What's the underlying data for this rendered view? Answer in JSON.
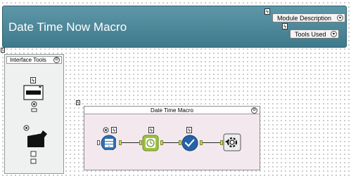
{
  "header": {
    "title": "Date Time Now Macro",
    "module_description_label": "Module Description",
    "tools_used_label": "Tools Used"
  },
  "interface_box": {
    "caption": "Interface Tools"
  },
  "macro_box": {
    "caption": "Date Time Macro"
  },
  "colors": {
    "header_bg": "#4a8799",
    "interface_bg": "#eef1ef",
    "macro_bg": "#f4e8ef"
  },
  "icons": {
    "lightning": "lightning-icon",
    "collapse": "collapse-icon"
  }
}
